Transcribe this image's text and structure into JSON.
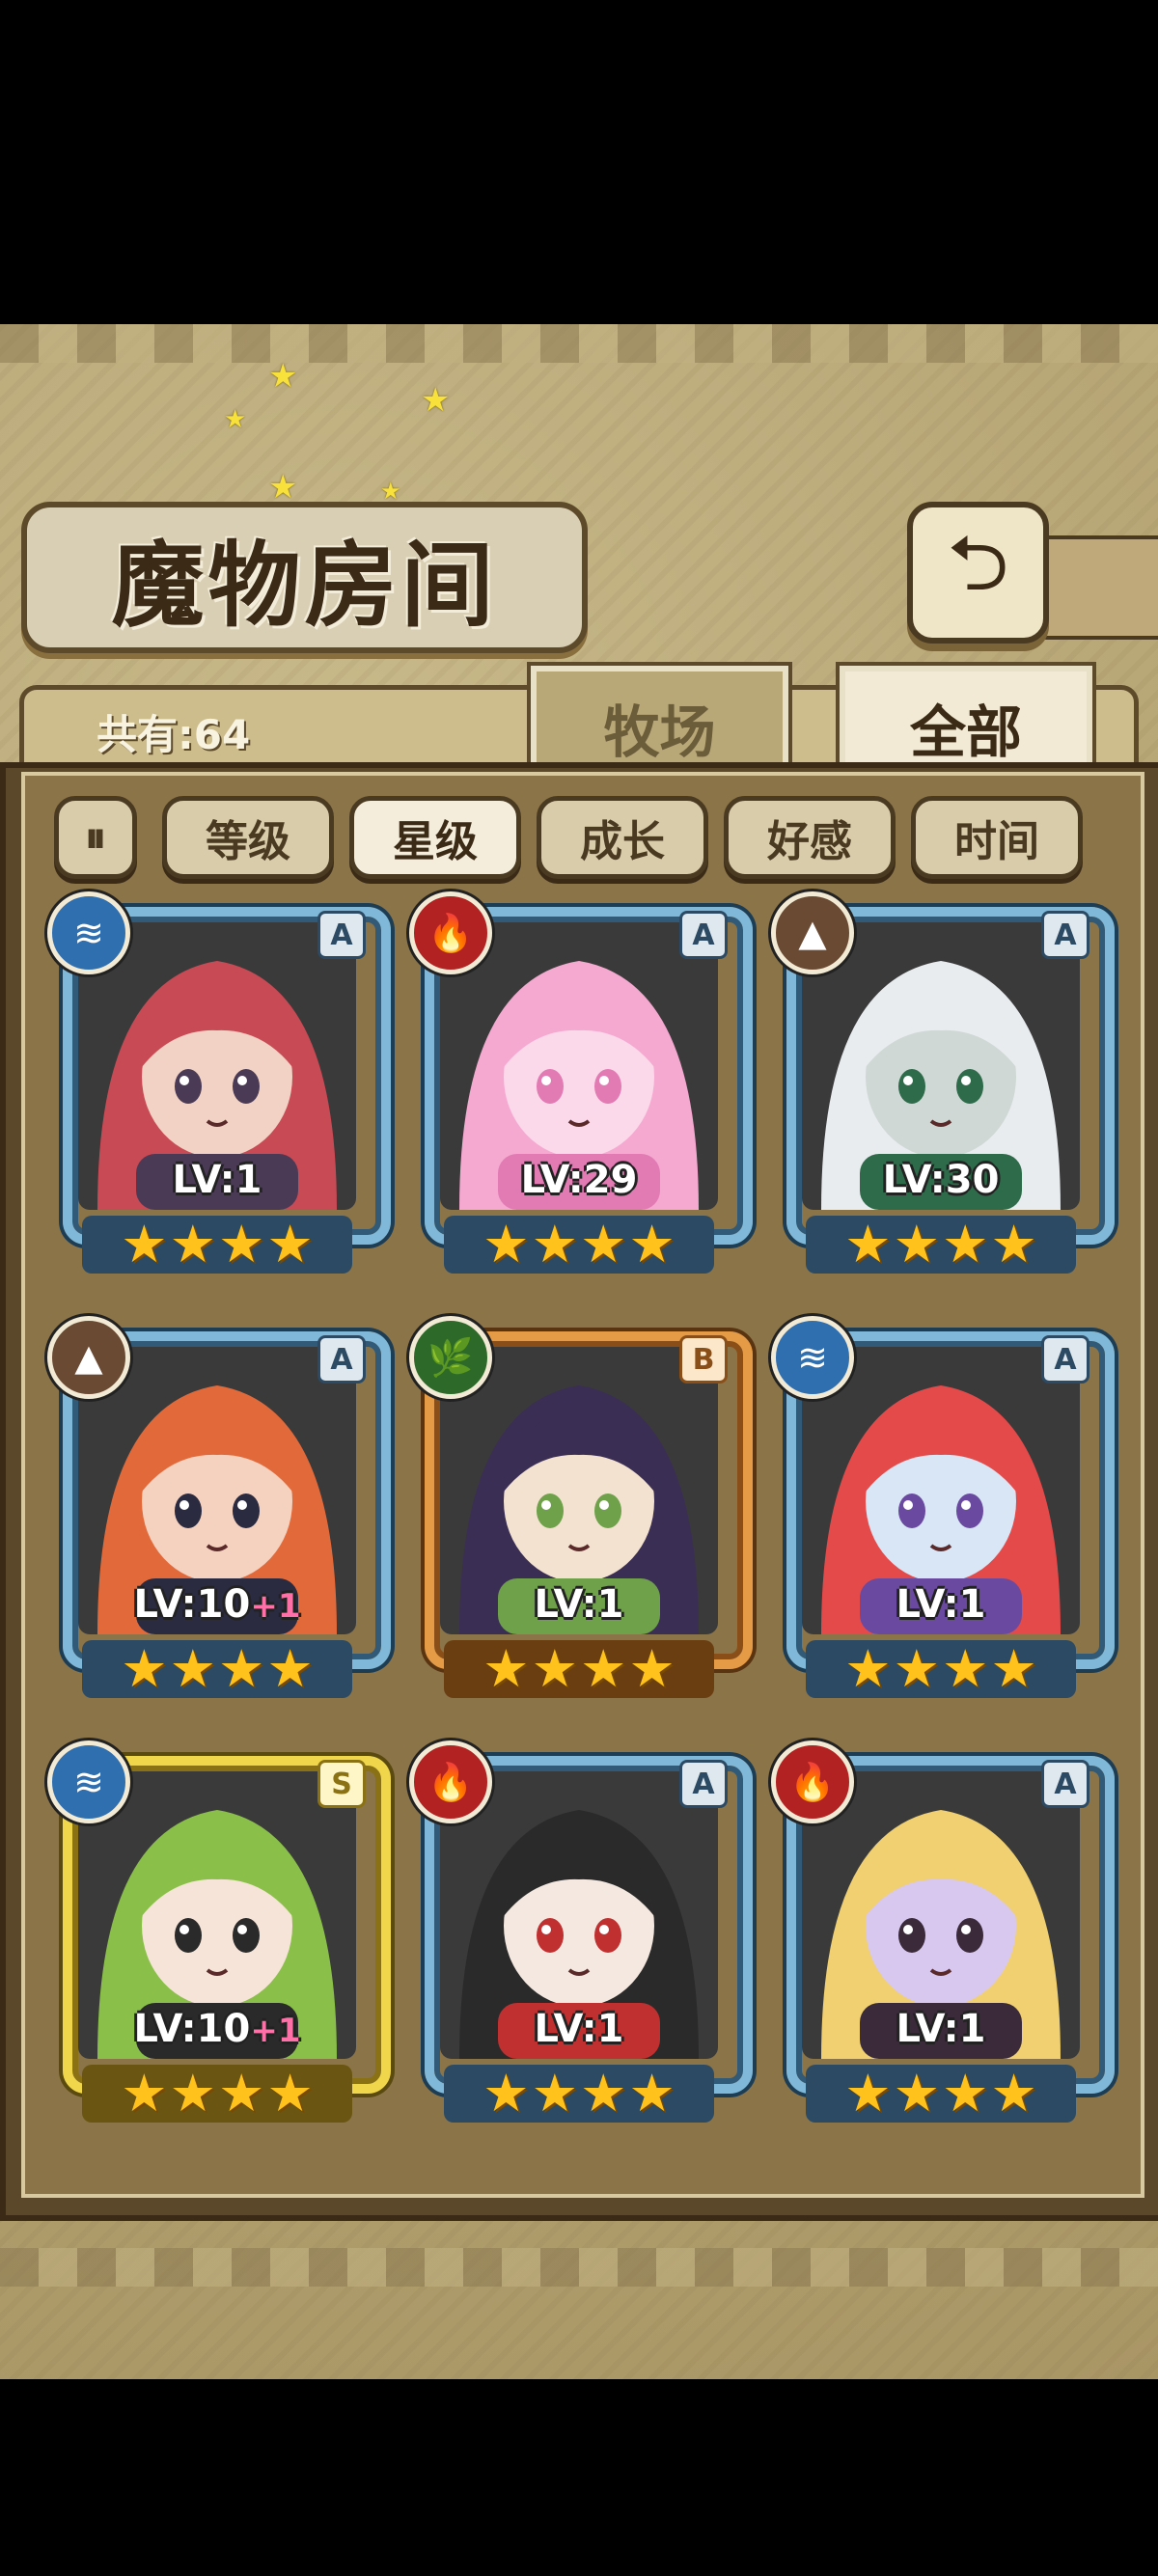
{
  "header": {
    "title": "魔物房间",
    "back_icon": "back-arrow-icon"
  },
  "summary": {
    "count_label": "共有:64"
  },
  "tabs": [
    {
      "label": "牧场",
      "active": false
    },
    {
      "label": "全部",
      "active": true
    }
  ],
  "sort": {
    "toggle_icon": "sort-toggle-icon",
    "options": [
      {
        "label": "等级",
        "active": false
      },
      {
        "label": "星级",
        "active": true
      },
      {
        "label": "成长",
        "active": false
      },
      {
        "label": "好感",
        "active": false
      },
      {
        "label": "时间",
        "active": false
      }
    ]
  },
  "monsters": [
    {
      "level": "LV:1",
      "bonus": "",
      "stars": 4,
      "rank": "A",
      "element": "water",
      "frame": "blue"
    },
    {
      "level": "LV:29",
      "bonus": "",
      "stars": 4,
      "rank": "A",
      "element": "fire",
      "frame": "blue"
    },
    {
      "level": "LV:30",
      "bonus": "",
      "stars": 4,
      "rank": "A",
      "element": "earth",
      "frame": "blue"
    },
    {
      "level": "LV:10",
      "bonus": "+1",
      "stars": 4,
      "rank": "A",
      "element": "earth",
      "frame": "blue"
    },
    {
      "level": "LV:1",
      "bonus": "",
      "stars": 4,
      "rank": "B",
      "element": "wood",
      "frame": "bronze"
    },
    {
      "level": "LV:1",
      "bonus": "",
      "stars": 4,
      "rank": "A",
      "element": "water",
      "frame": "blue"
    },
    {
      "level": "LV:10",
      "bonus": "+1",
      "stars": 4,
      "rank": "S",
      "element": "water",
      "frame": "gold"
    },
    {
      "level": "LV:1",
      "bonus": "",
      "stars": 4,
      "rank": "A",
      "element": "fire",
      "frame": "blue"
    },
    {
      "level": "LV:1",
      "bonus": "",
      "stars": 4,
      "rank": "A",
      "element": "fire",
      "frame": "blue"
    }
  ],
  "colors": {
    "frame_blue": "#7fb8d8",
    "frame_gold": "#f0d64a",
    "frame_bronze": "#e59a45",
    "star": "#ffc21c",
    "bonus": "#ff6fa8"
  }
}
